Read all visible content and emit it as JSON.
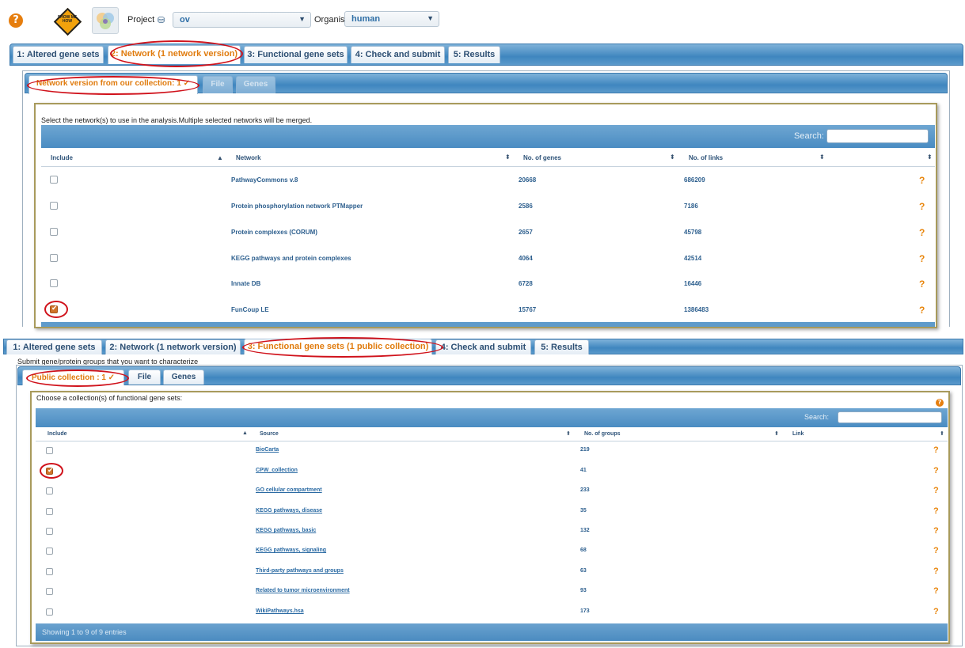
{
  "topbar": {
    "project_label": "Project",
    "project_value": "ov",
    "organism_label": "Organism",
    "organism_value": "human",
    "show_me_how": "SHOW ME HOW"
  },
  "tabs_top": [
    {
      "label": "1: Altered gene sets"
    },
    {
      "label": "2: Network (1 network version)"
    },
    {
      "label": "3: Functional gene sets"
    },
    {
      "label": "4: Check and submit"
    },
    {
      "label": "5: Results"
    }
  ],
  "network_subtabs": [
    {
      "label": "Network version from our collection: 1 ✓"
    },
    {
      "label": "File"
    },
    {
      "label": "Genes"
    }
  ],
  "network_panel": {
    "instruction": "Select the network(s) to use in the analysis.Multiple selected networks will be merged.",
    "search_label": "Search:",
    "columns": [
      "Include",
      "Network",
      "No. of genes",
      "No. of links"
    ],
    "rows": [
      {
        "network": "PathwayCommons v.8",
        "genes": "20668",
        "links": "686209",
        "checked": false
      },
      {
        "network": "Protein phosphorylation network PTMapper",
        "genes": "2586",
        "links": "7186",
        "checked": false
      },
      {
        "network": "Protein complexes (CORUM)",
        "genes": "2657",
        "links": "45798",
        "checked": false
      },
      {
        "network": "KEGG pathways and protein complexes",
        "genes": "4064",
        "links": "42514",
        "checked": false
      },
      {
        "network": "Innate DB",
        "genes": "6728",
        "links": "16446",
        "checked": false
      },
      {
        "network": "FunCoup LE",
        "genes": "15767",
        "links": "1386483",
        "checked": true
      }
    ],
    "help": "?"
  },
  "tabs_bottom": [
    {
      "label": "1: Altered gene sets"
    },
    {
      "label": "2: Network (1 network version)"
    },
    {
      "label": "3: Functional gene sets (1 public collection)"
    },
    {
      "label": "4: Check and submit"
    },
    {
      "label": "5: Results"
    }
  ],
  "fgs_intro": "Submit gene/protein groups that you want to characterize",
  "fgs_subtabs": [
    {
      "label": "Public collection : 1 ✓"
    },
    {
      "label": "File"
    },
    {
      "label": "Genes"
    }
  ],
  "fgs_panel": {
    "instruction": "Choose a collection(s) of functional gene sets:",
    "search_label": "Search:",
    "columns": [
      "Include",
      "Source",
      "No. of groups",
      "Link"
    ],
    "rows": [
      {
        "source": "BioCarta",
        "groups": "219",
        "checked": false
      },
      {
        "source": "CPW_collection",
        "groups": "41",
        "checked": true
      },
      {
        "source": "GO cellular compartment",
        "groups": "233",
        "checked": false
      },
      {
        "source": "KEGG pathways, disease",
        "groups": "35",
        "checked": false
      },
      {
        "source": "KEGG pathways, basic",
        "groups": "132",
        "checked": false
      },
      {
        "source": "KEGG pathways, signaling",
        "groups": "68",
        "checked": false
      },
      {
        "source": "Third-party pathways and groups",
        "groups": "63",
        "checked": false
      },
      {
        "source": "Related to tumor microenvironment",
        "groups": "93",
        "checked": false
      },
      {
        "source": "WikiPathways.hsa",
        "groups": "173",
        "checked": false
      }
    ],
    "footer": "Showing 1 to 9 of 9 entries",
    "help": "?"
  },
  "colors": {
    "accent_orange": "#e07b0d",
    "tab_blue": "#3f86bf",
    "highlight_red": "#d0121b"
  }
}
